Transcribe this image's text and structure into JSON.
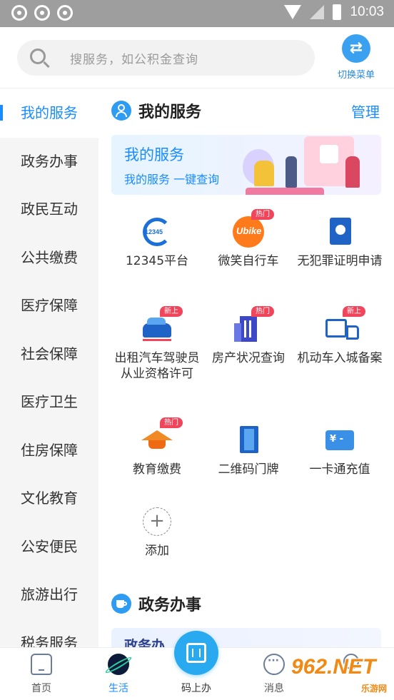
{
  "status_bar": {
    "time": "10:03"
  },
  "search": {
    "placeholder": "搜服务，如公积金查询"
  },
  "switch_menu": {
    "label": "切换菜单"
  },
  "left_nav": {
    "items": [
      {
        "label": "我的服务",
        "active": true
      },
      {
        "label": "政务办事"
      },
      {
        "label": "政民互动"
      },
      {
        "label": "公共缴费"
      },
      {
        "label": "医疗保障"
      },
      {
        "label": "社会保障"
      },
      {
        "label": "医疗卫生"
      },
      {
        "label": "住房保障"
      },
      {
        "label": "文化教育"
      },
      {
        "label": "公安便民"
      },
      {
        "label": "旅游出行"
      },
      {
        "label": "税务服务"
      }
    ]
  },
  "my_services": {
    "title": "我的服务",
    "manage_label": "管理",
    "banner": {
      "title": "我的服务",
      "subtitle": "我的服务 一键查询"
    },
    "tiles": [
      {
        "label": "12345平台",
        "icon": "hotline-12345-icon",
        "icon_text": "12345"
      },
      {
        "label": "微笑自行车",
        "icon": "bike-icon",
        "badge": "热门",
        "icon_text": "Ubike"
      },
      {
        "label": "无犯罪证明申请",
        "icon": "certificate-icon"
      },
      {
        "label": "出租汽车驾驶员从业资格许可",
        "icon": "taxi-icon",
        "badge": "新上"
      },
      {
        "label": "房产状况查询",
        "icon": "building-icon",
        "badge": "热门"
      },
      {
        "label": "机动车入城备案",
        "icon": "truck-icon",
        "badge": "新上"
      },
      {
        "label": "教育缴费",
        "icon": "graduation-cap-icon",
        "badge": "热门"
      },
      {
        "label": "二维码门牌",
        "icon": "door-icon"
      },
      {
        "label": "一卡通充值",
        "icon": "card-icon",
        "icon_text": "¥ -"
      },
      {
        "label": "添加",
        "icon": "add-icon"
      }
    ]
  },
  "gov_affairs": {
    "title": "政务办事",
    "card_title": "政务办"
  },
  "tab_bar": {
    "items": [
      {
        "label": "首页",
        "icon": "home-icon"
      },
      {
        "label": "生活",
        "icon": "planet-icon",
        "active": true
      },
      {
        "label": "码上办",
        "icon": "scan-icon"
      },
      {
        "label": "消息",
        "icon": "message-icon"
      },
      {
        "label": "我的",
        "icon": "user-icon"
      }
    ]
  },
  "watermark": {
    "text": "962.NET",
    "sub": "乐游网"
  },
  "colors": {
    "accent": "#1a8cff",
    "badge": "#f0455a",
    "scan": "#28a9f0"
  }
}
